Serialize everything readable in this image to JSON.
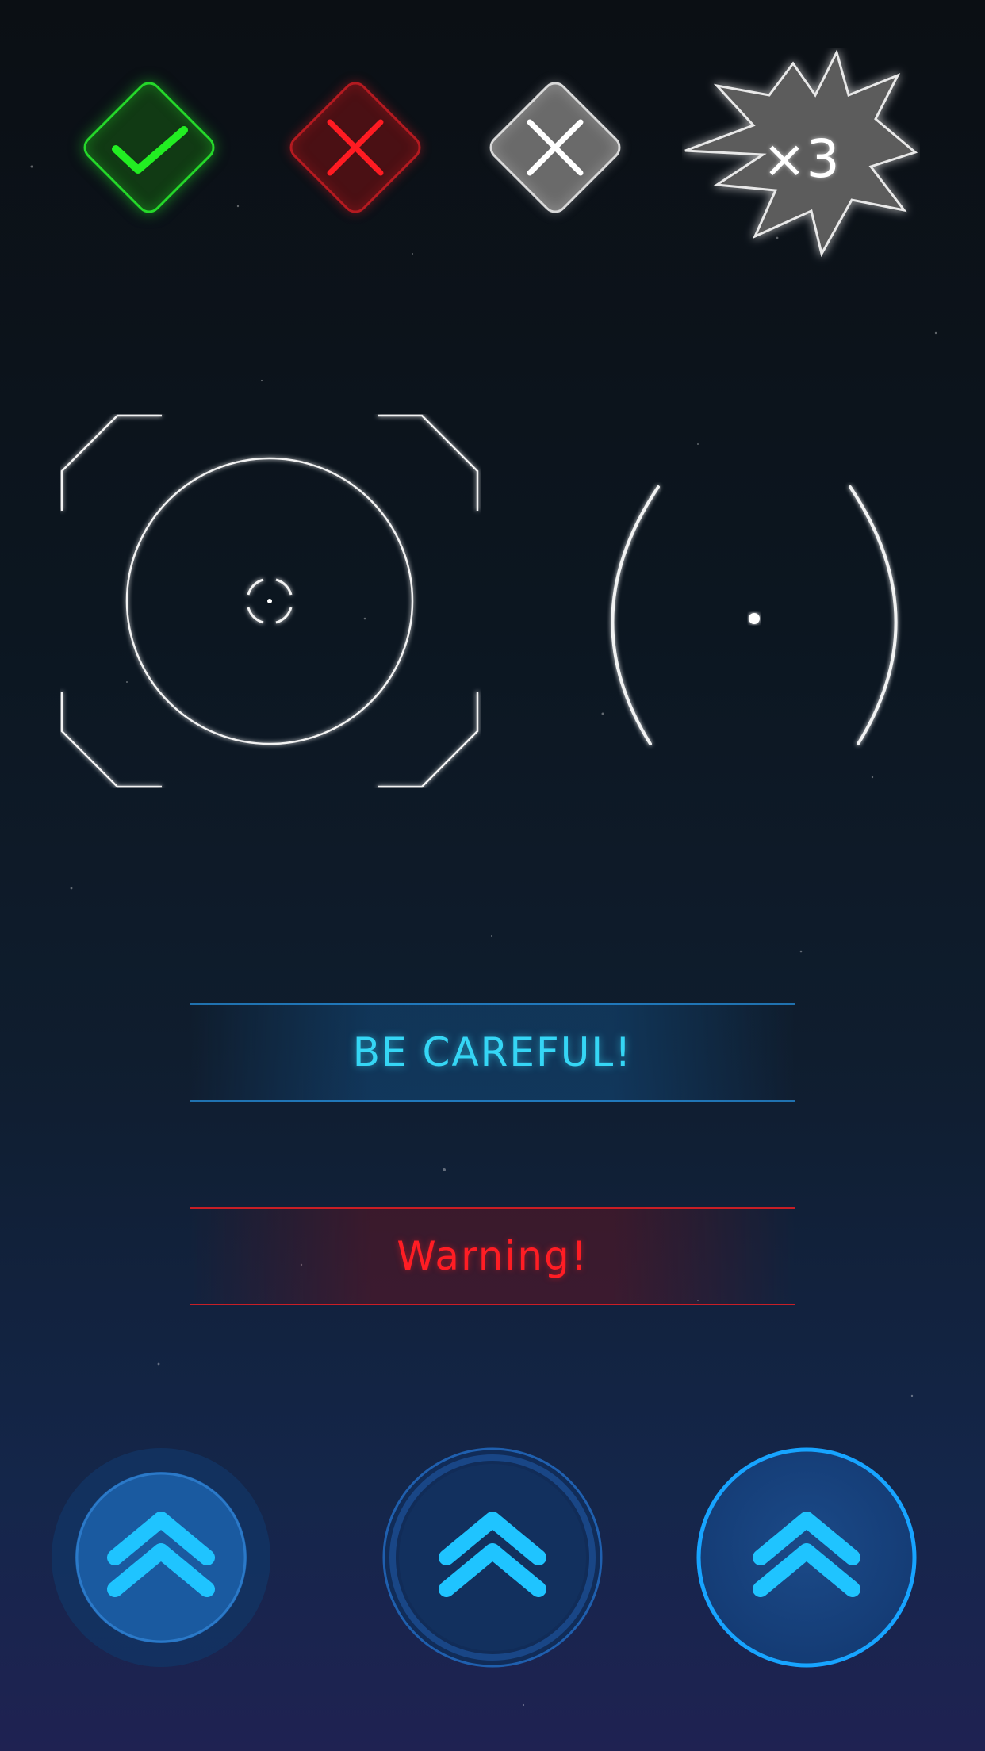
{
  "hud": {
    "confirm_icon": "checkmark-icon",
    "cancel_icon": "close-icon",
    "disabled_icon": "close-icon",
    "multiplier_text": "×3",
    "colors": {
      "confirm": "#1fdc1f",
      "cancel": "#ff1b22",
      "neutral": "#c9c9c9",
      "accent_blue": "#35d6f5",
      "warning_red": "#ff1d24",
      "button_blue": "#17a4ff"
    }
  },
  "targets": {
    "lock_reticle_icon": "crosshair-frame-icon",
    "scope_reticle_icon": "scope-reticle-icon"
  },
  "messages": {
    "careful": "BE CAREFUL!",
    "warning": "Warning!"
  },
  "controls": {
    "boost_icon": "double-chevron-up-icon",
    "buttons": [
      {
        "state": "normal"
      },
      {
        "state": "pressed"
      },
      {
        "state": "highlighted"
      }
    ]
  }
}
